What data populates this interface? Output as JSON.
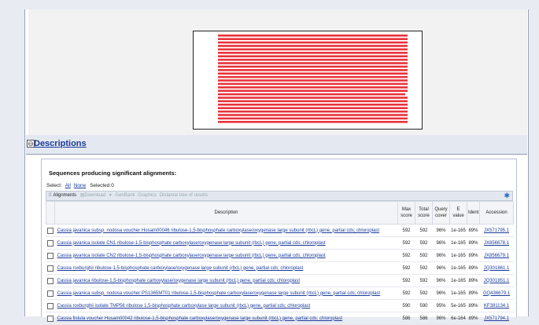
{
  "graphic": {
    "bar_color": "#e8323a",
    "line_count": 26
  },
  "descriptions": {
    "toggle": "⊖",
    "title": "Descriptions"
  },
  "results": {
    "heading": "Sequences producing significant alignments:",
    "select_label": "Select:",
    "select_all": "All",
    "select_none": "None",
    "selected_label": "Selected:0",
    "toolbar": {
      "alignments": "Alignments",
      "download": "Download",
      "genbank": "GenBank",
      "graphics": "Graphics",
      "distance_tree": "Distance tree of results"
    },
    "columns": {
      "description": "Description",
      "max_score": "Max score",
      "total_score": "Total score",
      "query_cover": "Query cover",
      "e_value": "E value",
      "ident": "Ident",
      "accession": "Accession"
    },
    "rows": [
      {
        "description": "Cassia javanica subsp. nodosa voucher Hosam00046 ribulose-1,5-bisphosphate carboxylase/oxygenase large subunit (rbcL) gene, partial cds; chloroplast",
        "max": "592",
        "total": "592",
        "cover": "96%",
        "e": "1e-165",
        "ident": "89%",
        "acc": "JX571795.1"
      },
      {
        "description": "Cassia javanica isolate CN1 ribulose-1,5-bisphosphate carboxylase/oxygenase large subunit (rbcL) gene, partial cds; chloroplast",
        "max": "592",
        "total": "592",
        "cover": "96%",
        "e": "1e-165",
        "ident": "89%",
        "acc": "JX856678.1"
      },
      {
        "description": "Cassia javanica isolate CN2 ribulose-1,5-bisphosphate carboxylase/oxygenase large subunit (rbcL) gene, partial cds; chloroplast",
        "max": "592",
        "total": "592",
        "cover": "96%",
        "e": "1e-165",
        "ident": "89%",
        "acc": "JX856679.1"
      },
      {
        "description": "Cassia roxburghii ribulose-1,5-bisphosphate carboxylase/oxygenase large subunit (rbcL) gene, partial cds; chloroplast",
        "max": "592",
        "total": "592",
        "cover": "96%",
        "e": "1e-165",
        "ident": "89%",
        "acc": "JQ301861.1"
      },
      {
        "description": "Cassia javanica ribulose-1,5-bisphosphate carboxylase/oxygenase large subunit (rbcL) gene, partial cds; chloroplast",
        "max": "592",
        "total": "592",
        "cover": "96%",
        "e": "1e-165",
        "ident": "89%",
        "acc": "JQ301851.1"
      },
      {
        "description": "Cassia javanica subsp. nodosa voucher PS1365MT01 ribulose-1,5-bisphosphate carboxylase/oxygenase large subunit (rbcL) gene, partial cds; chloroplast",
        "max": "592",
        "total": "592",
        "cover": "96%",
        "e": "1e-165",
        "ident": "89%",
        "acc": "GQ436679.1"
      },
      {
        "description": "Cassia roxburghii isolate TMP56 ribulose 1,5-bisphosphate carboxylase large subunit (rbcL) gene, partial cds; chloroplast",
        "max": "590",
        "total": "590",
        "cover": "95%",
        "e": "5e-165",
        "ident": "89%",
        "acc": "KF381134.1"
      },
      {
        "description": "Cassia fistula voucher Hosam00042 ribulose-1,5-bisphosphate carboxylase/oxygenase large subunit (rbcL) gene, partial cds; chloroplast",
        "max": "586",
        "total": "586",
        "cover": "96%",
        "e": "6e-164",
        "ident": "89%",
        "acc": "JX571794.1"
      }
    ]
  }
}
